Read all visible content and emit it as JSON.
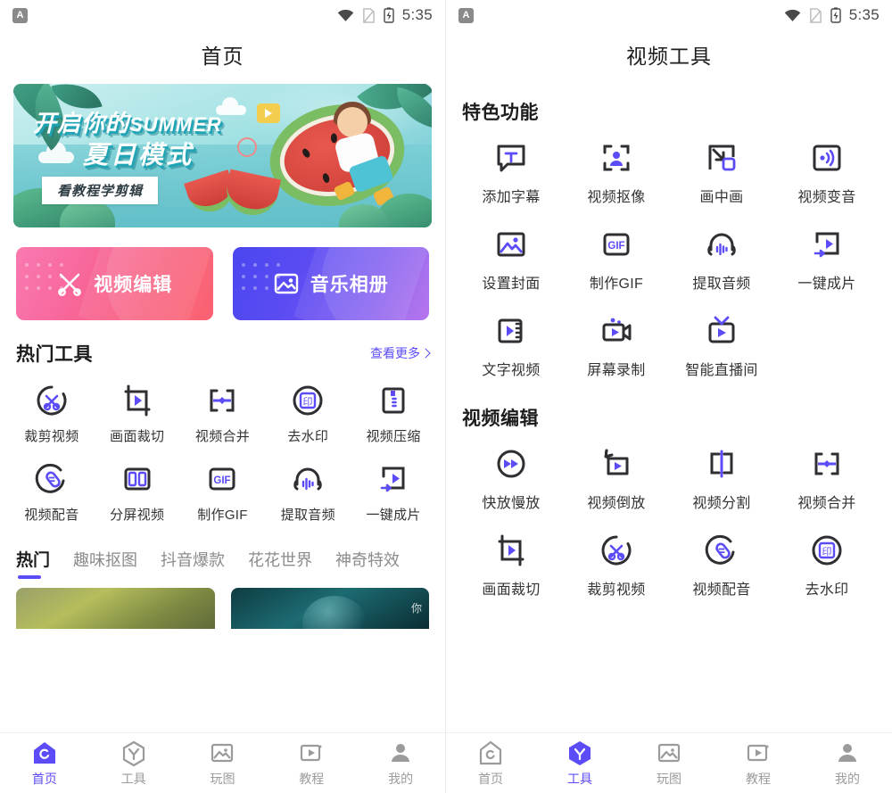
{
  "accent": "#5b4cf7",
  "status_bar": {
    "app_icon": "A",
    "time": "5:35",
    "icons": [
      "wifi-icon",
      "sim-card-icon",
      "battery-charging-icon"
    ]
  },
  "left_screen": {
    "title": "首页",
    "banner": {
      "line1_cn": "开启你的",
      "line1_en": "SUMMER",
      "line2": "夏日模式",
      "button_label": "看教程学剪辑",
      "button_highlight": "看教"
    },
    "cards": [
      {
        "label": "视频编辑",
        "icon": "scissors-icon",
        "color_from": "#f97ab0",
        "color_to": "#fa4f5f"
      },
      {
        "label": "音乐相册",
        "icon": "photo-icon",
        "color_from": "#4b46f0",
        "color_to": "#b065ec"
      }
    ],
    "hot_tools": {
      "title": "热门工具",
      "more_label": "查看更多",
      "items": [
        {
          "label": "裁剪视频",
          "icon": "trim-video-icon"
        },
        {
          "label": "画面裁切",
          "icon": "crop-frame-icon"
        },
        {
          "label": "视频合并",
          "icon": "merge-video-icon"
        },
        {
          "label": "去水印",
          "icon": "remove-watermark-icon"
        },
        {
          "label": "视频压缩",
          "icon": "compress-video-icon"
        },
        {
          "label": "视频配音",
          "icon": "dubbing-icon"
        },
        {
          "label": "分屏视频",
          "icon": "split-screen-icon"
        },
        {
          "label": "制作GIF",
          "icon": "gif-icon"
        },
        {
          "label": "提取音频",
          "icon": "extract-audio-icon"
        },
        {
          "label": "一键成片",
          "icon": "one-tap-movie-icon"
        }
      ]
    },
    "tabs": [
      {
        "label": "热门",
        "active": true
      },
      {
        "label": "趣味抠图",
        "active": false
      },
      {
        "label": "抖音爆款",
        "active": false
      },
      {
        "label": "花花世界",
        "active": false
      },
      {
        "label": "神奇特效",
        "active": false
      }
    ],
    "feed": [
      {
        "name": "thumbnail-green-foliage"
      },
      {
        "name": "thumbnail-dark-teal",
        "watermark": "你"
      }
    ]
  },
  "right_screen": {
    "title": "视频工具",
    "featured": {
      "title": "特色功能",
      "items": [
        {
          "label": "添加字幕",
          "icon": "subtitle-icon"
        },
        {
          "label": "视频抠像",
          "icon": "matting-icon"
        },
        {
          "label": "画中画",
          "icon": "picture-in-picture-icon"
        },
        {
          "label": "视频变音",
          "icon": "voice-change-icon"
        },
        {
          "label": "设置封面",
          "icon": "set-cover-icon"
        },
        {
          "label": "制作GIF",
          "icon": "gif-icon"
        },
        {
          "label": "提取音频",
          "icon": "extract-audio-icon"
        },
        {
          "label": "一键成片",
          "icon": "one-tap-movie-icon"
        },
        {
          "label": "文字视频",
          "icon": "text-video-icon"
        },
        {
          "label": "屏幕录制",
          "icon": "screen-record-icon"
        },
        {
          "label": "智能直播间",
          "icon": "live-room-icon"
        }
      ]
    },
    "editing": {
      "title": "视频编辑",
      "items": [
        {
          "label": "快放慢放",
          "icon": "speed-icon"
        },
        {
          "label": "视频倒放",
          "icon": "reverse-video-icon"
        },
        {
          "label": "视频分割",
          "icon": "split-video-icon"
        },
        {
          "label": "视频合并",
          "icon": "merge-video-icon"
        },
        {
          "label": "画面裁切",
          "icon": "crop-frame-icon"
        },
        {
          "label": "裁剪视频",
          "icon": "trim-video-icon"
        },
        {
          "label": "视频配音",
          "icon": "dubbing-icon"
        },
        {
          "label": "去水印",
          "icon": "remove-watermark-icon"
        }
      ]
    }
  },
  "bottom_nav": {
    "left_active_index": 0,
    "right_active_index": 1,
    "items": [
      {
        "label": "首页",
        "icon": "home-icon"
      },
      {
        "label": "工具",
        "icon": "tools-icon"
      },
      {
        "label": "玩图",
        "icon": "image-icon"
      },
      {
        "label": "教程",
        "icon": "tutorial-icon"
      },
      {
        "label": "我的",
        "icon": "profile-icon"
      }
    ]
  }
}
